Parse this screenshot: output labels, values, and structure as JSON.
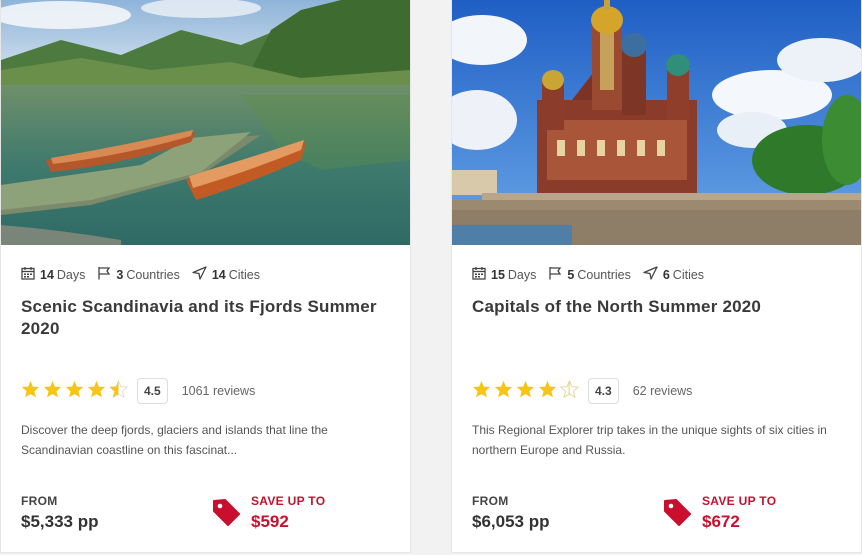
{
  "cards": [
    {
      "image_alt": "Fjord with wooden rowboats at a dock",
      "days": "14",
      "days_label": "Days",
      "countries": "3",
      "countries_label": "Countries",
      "cities": "14",
      "cities_label": "Cities",
      "title": "Scenic Scandinavia and its Fjords Summer 2020",
      "rating": 4.5,
      "rating_text": "4.5",
      "reviews": "1061 reviews",
      "description": "Discover the deep fjords, glaciers and islands that line the Scandinavian coastline on this fascinat...",
      "from_label": "FROM",
      "price": "$5,333 pp",
      "save_label": "SAVE UP TO",
      "save_amount": "$592"
    },
    {
      "image_alt": "Church of the Savior on Spilled Blood",
      "days": "15",
      "days_label": "Days",
      "countries": "5",
      "countries_label": "Countries",
      "cities": "6",
      "cities_label": "Cities",
      "title": "Capitals of the North Summer 2020",
      "rating": 4.3,
      "rating_text": "4.3",
      "reviews": "62 reviews",
      "description": "This Regional Explorer trip takes in the unique sights of six cities in northern Europe and Russia.",
      "from_label": "FROM",
      "price": "$6,053 pp",
      "save_label": "SAVE UP TO",
      "save_amount": "$672"
    }
  ],
  "colors": {
    "accent": "#c8102e",
    "star": "#f5c518",
    "text": "#3a3a3a"
  },
  "icons": [
    "calendar-icon",
    "flag-icon",
    "navigation-icon",
    "star-icon",
    "price-tag-icon"
  ]
}
